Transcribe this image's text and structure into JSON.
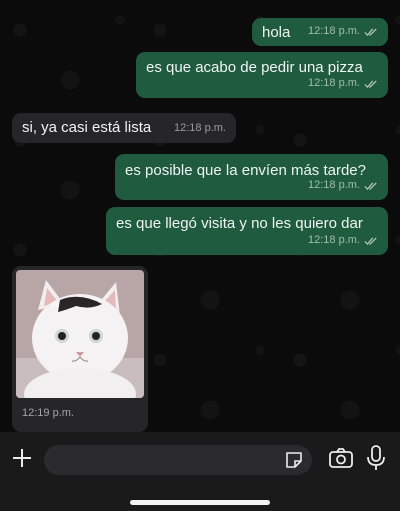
{
  "messages": [
    {
      "dir": "out",
      "text": "hola",
      "time": "12:18 p.m."
    },
    {
      "dir": "out",
      "text": "es que acabo de pedir una pizza",
      "time": "12:18 p.m."
    },
    {
      "dir": "in",
      "text": "si, ya casi está lista",
      "time": "12:18 p.m."
    },
    {
      "dir": "out",
      "text": "es posible que la envíen más tarde?",
      "time": "12:18 p.m."
    },
    {
      "dir": "out",
      "text": "es que llegó visita y no les quiero dar",
      "time": "12:18 p.m."
    },
    {
      "dir": "in",
      "type": "image",
      "content": "cat-photo",
      "time": "12:19 p.m."
    }
  ],
  "composer": {
    "placeholder": ""
  },
  "icons": [
    "plus-icon",
    "sticker-icon",
    "camera-icon",
    "microphone-icon",
    "double-check-icon"
  ],
  "colors": {
    "outgoing_bubble": "#1f5b3e",
    "incoming_bubble": "#262628",
    "ticks": "#b9c7c0"
  }
}
